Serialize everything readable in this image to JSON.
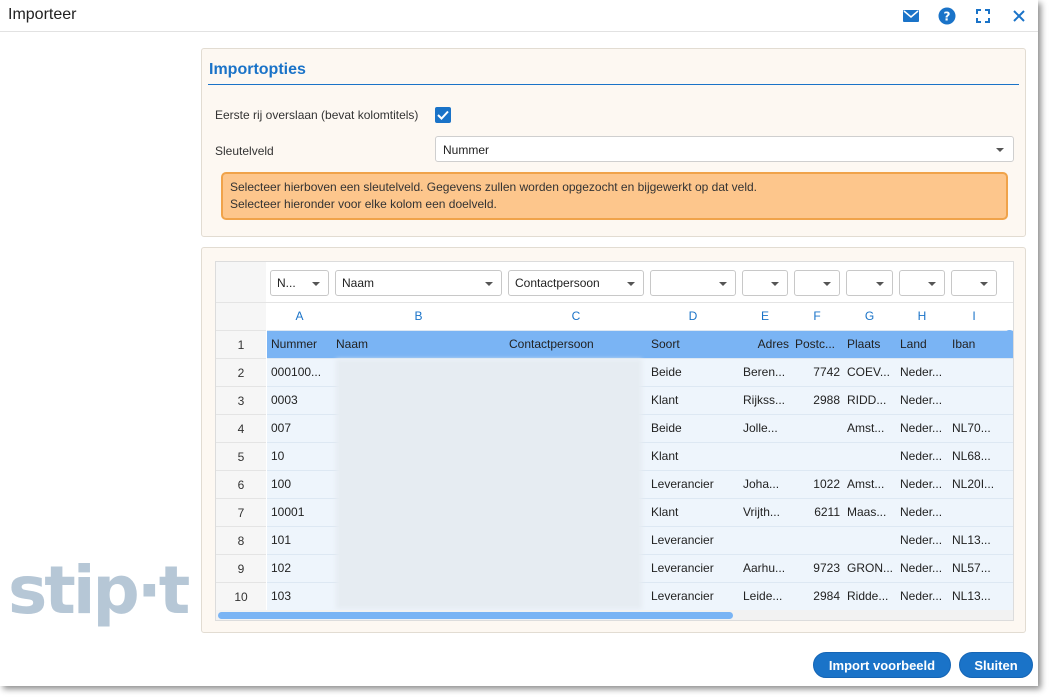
{
  "window": {
    "title": "Importeer"
  },
  "brand": {
    "logo_text": "stip·t"
  },
  "colors": {
    "accent": "#1a73c8",
    "info_bg": "#fdc68c",
    "header_row": "#7ab4f4"
  },
  "options": {
    "title": "Importopties",
    "skip_first_row_label": "Eerste rij overslaan (bevat kolomtitels)",
    "skip_first_row_checked": true,
    "key_field_label": "Sleutelveld",
    "key_field_value": "Nummer",
    "info_line1": "Selecteer hierboven een sleutelveld. Gegevens zullen worden opgezocht en bijgewerkt op dat veld.",
    "info_line2": "Selecteer hieronder voor elke kolom een doelveld."
  },
  "grid": {
    "mapping": [
      "N...",
      "Naam",
      "Contactpersoon",
      "",
      "",
      "",
      "",
      "",
      ""
    ],
    "letters": [
      "A",
      "B",
      "C",
      "D",
      "E",
      "F",
      "G",
      "H",
      "I"
    ],
    "header_row": [
      "Nummer",
      "Naam",
      "Contactpersoon",
      "Soort",
      "Adres",
      "Postc...",
      "Plaats",
      "Land",
      "Iban"
    ],
    "rows": [
      {
        "n": "2",
        "a": "000100...",
        "d": "Beide",
        "e": "Beren...",
        "f": "7742",
        "g": "COEV...",
        "h": "Neder...",
        "i": ""
      },
      {
        "n": "3",
        "a": "0003",
        "d": "Klant",
        "e": "Rijkss...",
        "f": "2988",
        "g": "RIDD...",
        "h": "Neder...",
        "i": ""
      },
      {
        "n": "4",
        "a": "007",
        "d": "Beide",
        "e": "Jolle...",
        "f": "",
        "g": "Amst...",
        "h": "Neder...",
        "i": "NL70..."
      },
      {
        "n": "5",
        "a": "10",
        "d": "Klant",
        "e": "",
        "f": "",
        "g": "",
        "h": "Neder...",
        "i": "NL68..."
      },
      {
        "n": "6",
        "a": "100",
        "d": "Leverancier",
        "e": "Joha...",
        "f": "1022",
        "g": "Amst...",
        "h": "Neder...",
        "i": "NL20I..."
      },
      {
        "n": "7",
        "a": "10001",
        "d": "Klant",
        "e": "Vrijth...",
        "f": "6211",
        "g": "Maas...",
        "h": "Neder...",
        "i": ""
      },
      {
        "n": "8",
        "a": "101",
        "d": "Leverancier",
        "e": "",
        "f": "",
        "g": "",
        "h": "Neder...",
        "i": "NL13..."
      },
      {
        "n": "9",
        "a": "102",
        "d": "Leverancier",
        "e": "Aarhu...",
        "f": "9723",
        "g": "GRON...",
        "h": "Neder...",
        "i": "NL57..."
      },
      {
        "n": "10",
        "a": "103",
        "d": "Leverancier",
        "e": "Leide...",
        "f": "2984",
        "g": "Ridde...",
        "h": "Neder...",
        "i": "NL13..."
      }
    ]
  },
  "buttons": {
    "preview": "Import voorbeeld",
    "close": "Sluiten"
  }
}
